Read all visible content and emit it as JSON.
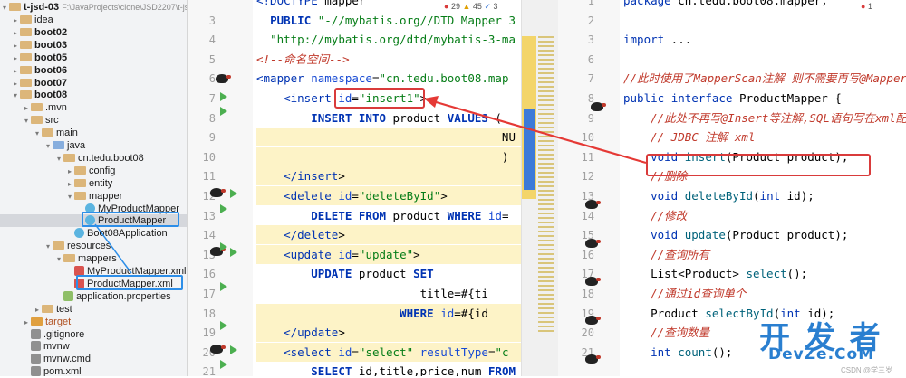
{
  "tree": {
    "root": "t-jsd-03",
    "root_path": "F:\\JavaProjects\\clone\\JSD2207\\t-js",
    "items": [
      {
        "label": "idea",
        "prefix": ".",
        "level": 1
      },
      {
        "label": "boot02",
        "level": 1
      },
      {
        "label": "boot03",
        "level": 1
      },
      {
        "label": "boot05",
        "level": 1
      },
      {
        "label": "boot06",
        "level": 1
      },
      {
        "label": "boot07",
        "level": 1
      },
      {
        "label": "boot08",
        "level": 1
      },
      {
        "label": ".mvn",
        "level": 2
      },
      {
        "label": "src",
        "level": 2
      },
      {
        "label": "main",
        "level": 3
      },
      {
        "label": "java",
        "level": 4
      },
      {
        "label": "cn.tedu.boot08",
        "level": 5
      },
      {
        "label": "config",
        "level": 6
      },
      {
        "label": "entity",
        "level": 6
      },
      {
        "label": "mapper",
        "level": 6
      },
      {
        "label": "MyProductMapper",
        "level": 7
      },
      {
        "label": "ProductMapper",
        "level": 7
      },
      {
        "label": "Boot08Application",
        "level": 6
      },
      {
        "label": "resources",
        "level": 4
      },
      {
        "label": "mappers",
        "level": 5
      },
      {
        "label": "MyProductMapper.xml",
        "level": 6
      },
      {
        "label": "ProductMapper.xml",
        "level": 6
      },
      {
        "label": "application.properties",
        "level": 5
      },
      {
        "label": "test",
        "level": 3
      },
      {
        "label": "target",
        "level": 2
      },
      {
        "label": ".gitignore",
        "level": 2
      },
      {
        "label": "mvnw",
        "level": 2
      },
      {
        "label": "mvnw.cmd",
        "level": 2
      },
      {
        "label": "pom.xml",
        "level": 2
      }
    ]
  },
  "xml_editor": {
    "inspection": {
      "errors": "29",
      "warnings": "45",
      "typos": "3"
    },
    "lines": [
      {
        "n": "",
        "t": "<!DOCTYPE mapper"
      },
      {
        "n": "3",
        "t": "  PUBLIC \"-//mybatis.org//DTD Mapper 3"
      },
      {
        "n": "4",
        "t": "  \"http://mybatis.org/dtd/mybatis-3-ma"
      },
      {
        "n": "5",
        "t": "<!--命名空间-->"
      },
      {
        "n": "6",
        "t": "<mapper namespace=\"cn.tedu.boot08.map"
      },
      {
        "n": "7",
        "t": "    <insert id=\"insert1\">"
      },
      {
        "n": "8",
        "t": "        INSERT INTO product VALUES ("
      },
      {
        "n": "9",
        "t": "                                    NU"
      },
      {
        "n": "10",
        "t": "                                    )"
      },
      {
        "n": "11",
        "t": "    </insert>"
      },
      {
        "n": "12",
        "t": "    <delete id=\"deleteById\">"
      },
      {
        "n": "13",
        "t": "        DELETE FROM product WHERE id="
      },
      {
        "n": "14",
        "t": "    </delete>"
      },
      {
        "n": "15",
        "t": "    <update id=\"update\">"
      },
      {
        "n": "16",
        "t": "        UPDATE product SET"
      },
      {
        "n": "17",
        "t": "                        title=#{ti"
      },
      {
        "n": "18",
        "t": "                     WHERE id=#{id"
      },
      {
        "n": "19",
        "t": "    </update>"
      },
      {
        "n": "20",
        "t": "    <select id=\"select\" resultType=\"c"
      },
      {
        "n": "21",
        "t": "        SELECT id,title,price,num FROM"
      }
    ]
  },
  "java_editor": {
    "inspection": {
      "errors": "1"
    },
    "lines": [
      {
        "n": "1",
        "t": "package cn.tedu.boot08.mapper;"
      },
      {
        "n": "2",
        "t": ""
      },
      {
        "n": "3",
        "t": "import ..."
      },
      {
        "n": "6",
        "t": ""
      },
      {
        "n": "7",
        "t": "//此时使用了MapperScan注解 则不需要再写@Mapper"
      },
      {
        "n": "8",
        "t": "public interface ProductMapper {"
      },
      {
        "n": "9",
        "t": "    //此处不再写@Insert等注解,SQL语句写在xml配"
      },
      {
        "n": "10",
        "t": "    // JDBC 注解 xml"
      },
      {
        "n": "11",
        "t": "    void insert(Product product);"
      },
      {
        "n": "12",
        "t": "    //删除"
      },
      {
        "n": "13",
        "t": "    void deleteById(int id);"
      },
      {
        "n": "14",
        "t": "    //修改"
      },
      {
        "n": "15",
        "t": "    void update(Product product);"
      },
      {
        "n": "16",
        "t": "    //查询所有"
      },
      {
        "n": "17",
        "t": "    List<Product> select();"
      },
      {
        "n": "18",
        "t": "    //通过id查询单个"
      },
      {
        "n": "19",
        "t": "    Product selectById(int id);"
      },
      {
        "n": "20",
        "t": "    //查询数量"
      },
      {
        "n": "21",
        "t": "    int count();"
      }
    ]
  },
  "watermark": {
    "main": "开 发 者",
    "sub": "DevZe.CoM",
    "small": "CSDN @学三岁"
  },
  "colors": {
    "arrow": "#e53935",
    "selection": "#2d8ee8"
  }
}
